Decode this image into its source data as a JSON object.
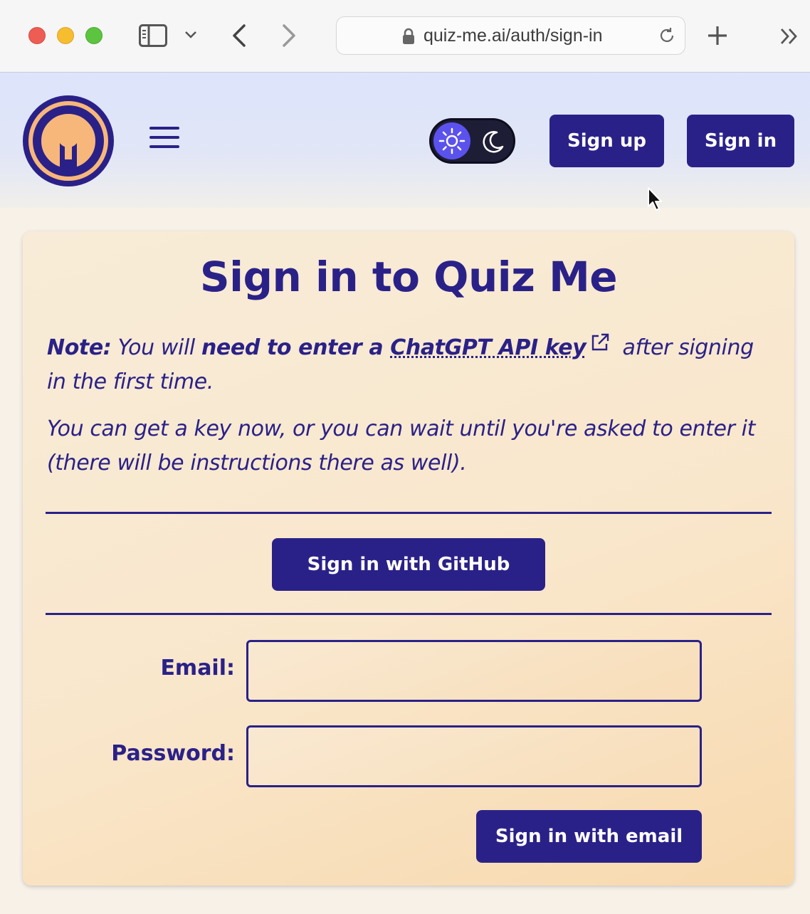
{
  "browser": {
    "url": "quiz-me.ai/auth/sign-in"
  },
  "header": {
    "sign_up_label": "Sign up",
    "sign_in_label": "Sign in",
    "theme_toggle_state": "light"
  },
  "card": {
    "title": "Sign in to Quiz Me",
    "note_lead": "Note:",
    "note_text_1": " You will ",
    "note_bold": "need to enter a ",
    "note_link": "ChatGPT API key",
    "note_text_2": " after signing in the first time.",
    "note_second": "You can get a key now, or you can wait until you're asked to enter it (there will be instructions there as well).",
    "github_button": "Sign in with GitHub",
    "email_label": "Email:",
    "email_value": "",
    "password_label": "Password:",
    "password_value": "",
    "email_button": "Sign in with email"
  },
  "colors": {
    "brand": "#2a2188",
    "accent": "#5b52ee",
    "logo_fill": "#f8b77a"
  }
}
